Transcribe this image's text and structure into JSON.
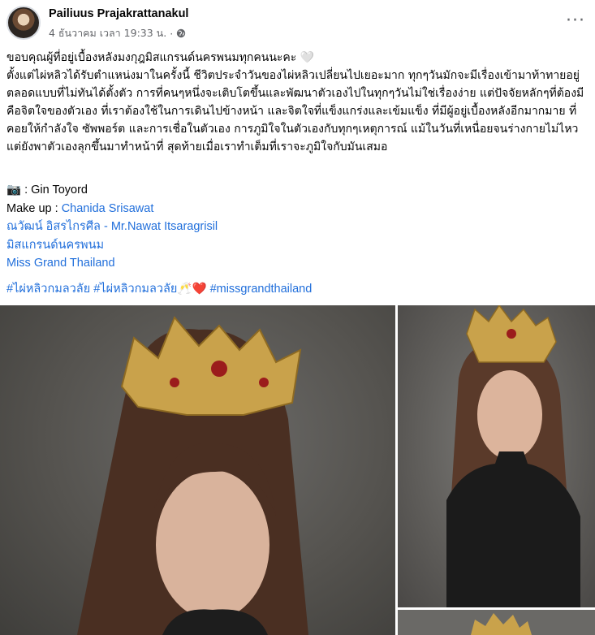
{
  "post": {
    "author": "Pailiuus Prajakrattanakul",
    "timestamp": "4 ธันวาคม เวลา 19:33 น.",
    "separator": "·",
    "more_icon": "more-horizontal-icon",
    "privacy_icon": "globe-icon"
  },
  "body": {
    "paragraph1": "ขอบคุณผู้ที่อยู่เบื้องหลังมงกุฎมิสแกรนด์นครพนมทุกคนนะคะ 🤍",
    "paragraph2": "ตั้งแต่ไผ่หลิวได้รับตำแหน่งมาในครั้งนี้ ชีวิตประจำวันของไผ่หลิวเปลี่ยนไปเยอะมาก ทุกๆวันมักจะมีเรื่องเข้ามาท้าทายอยู่ตลอดแบบที่ไม่ทันได้ตั้งตัว การที่คนๆหนึ่งจะเติบโตขึ้นและพัฒนาตัวเองไปในทุกๆวันไม่ใช่เรื่องง่าย แต่ปัจจัยหลักๆที่ต้องมีคือจิตใจของตัวเอง ที่เราต้องใช้ในการเดินไปข้างหน้า และจิตใจที่แข็งแกร่งและเข้มแข็ง ที่มีผู้อยู่เบื้องหลังอีกมากมาย ที่คอยให้กำลังใจ ซัพพอร์ต และการเชื่อในตัวเอง การภูมิใจในตัวเองกับทุกๆเหตุการณ์ แม้ในวันที่เหนื่อยจนร่างกายไม่ไหวแต่ยังพาตัวเองลุกขึ้นมาทำหน้าที่ สุดท้ายเมื่อเราทำเต็มที่เราจะภูมิใจกับมันเสมอ"
  },
  "credits": {
    "photo_prefix": "📷 : Gin Toyord",
    "makeup_prefix": "Make up : ",
    "makeup_link": "Chanida Srisawat",
    "tag1": "ณวัฒน์ อิสรไกรศีล - Mr.Nawat Itsaragrisil",
    "tag2": "มิสแกรนด์นครพนม",
    "tag3": "Miss Grand Thailand"
  },
  "hashtags": {
    "h1": "#ไผ่หลิวกมลวลัย",
    "h2": "#ไผ่หลิวกมลวลัย",
    "emoji": "🥂",
    "heart": "❤️",
    "h3": "#missgrandthailand"
  },
  "photos": {
    "main_alt": "portrait photo with crown",
    "side_alt": "portrait photo with crown in black turtleneck"
  },
  "colors": {
    "link": "#216fdb",
    "meta": "#65676b",
    "text": "#050505"
  }
}
